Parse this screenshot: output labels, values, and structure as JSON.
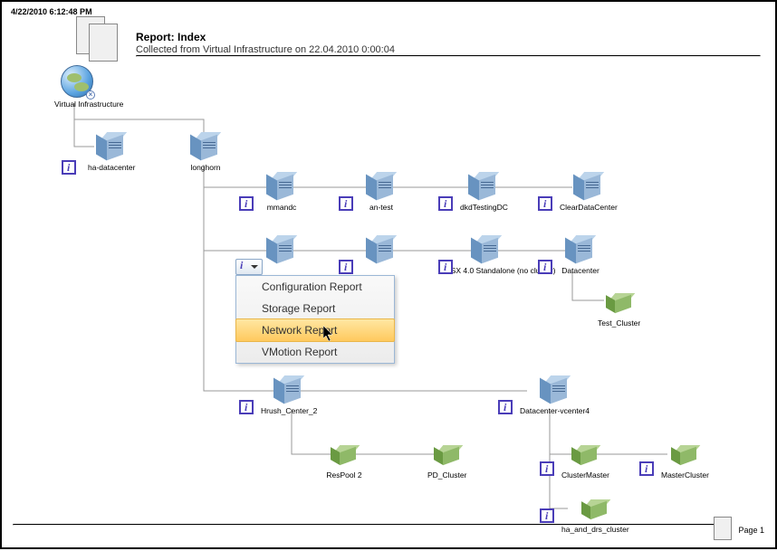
{
  "timestamp": "4/22/2010 6:12:48 PM",
  "title": "Report: Index",
  "subtitle": "Collected from Virtual Infrastructure on 22.04.2010 0:00:04",
  "footer_page": "Page 1",
  "root": {
    "label": "Virtual Infrastructure"
  },
  "menu": {
    "items": [
      "Configuration Report",
      "Storage Report",
      "Network Report",
      "VMotion Report"
    ],
    "highlighted_index": 2
  },
  "nodes": {
    "ha_datacenter": "ha-datacenter",
    "longhorn": "longhorn",
    "mmandc": "mmandc",
    "an_test": "an-test",
    "dkdTestingDC": "dkdTestingDC",
    "ClearDataCenter": "ClearDataCenter",
    "hidden1": "",
    "hidden2": "",
    "esx40": "ESX 4.0 Standalone (no cluster)",
    "Datacenter": "Datacenter",
    "Test_Cluster": "Test_Cluster",
    "Hrush_Center_2": "Hrush_Center_2",
    "Datacenter_vcenter4": "Datacenter-vcenter4",
    "ResPool2": "ResPool 2",
    "PD_Cluster": "PD_Cluster",
    "ClusterMaster": "ClusterMaster",
    "MasterCluster": "MasterCluster",
    "ha_and_drs_cluster": "ha_and_drs_cluster"
  }
}
